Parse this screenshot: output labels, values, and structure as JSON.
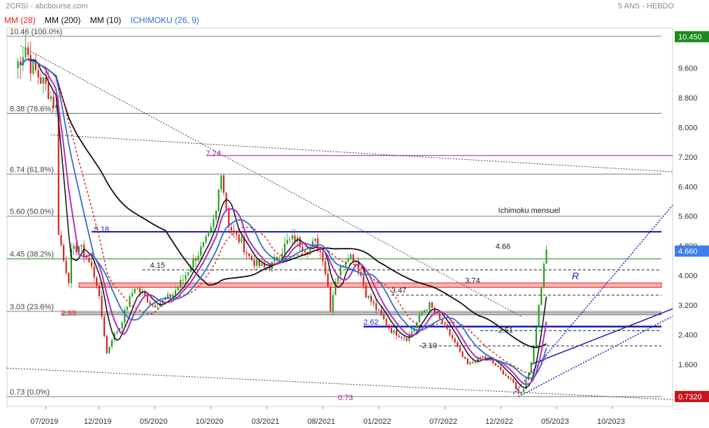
{
  "header": {
    "source": "2CRSI - abcbourse.com",
    "period": "5 ANS - HEBDO"
  },
  "legend": [
    {
      "label": "MM (28)",
      "color": "#e8271e"
    },
    {
      "label": "MM (200)",
      "color": "#111111"
    },
    {
      "label": "MM (10)",
      "color": "#111111"
    },
    {
      "label": "ICHIMOKU (26, 9)",
      "color": "#2f6fd6"
    }
  ],
  "chart_data": {
    "type": "candlestick",
    "y_ticks": [
      "10.400",
      "9.600",
      "8.800",
      "8.000",
      "7.200",
      "6.400",
      "5.600",
      "4.800",
      "4.000",
      "3.200",
      "2.400",
      "1.600",
      "0.8000"
    ],
    "y_tick_values": [
      10.4,
      9.6,
      8.8,
      8.0,
      7.2,
      6.4,
      5.6,
      4.8,
      4.0,
      3.2,
      2.4,
      1.6,
      0.8
    ],
    "ylim": [
      0.73,
      10.46
    ],
    "x_ticks": [
      "07/2019",
      "12/2019",
      "05/2020",
      "10/2020",
      "03/2021",
      "08/2021",
      "01/2022",
      "07/2022",
      "12/2022",
      "05/2023",
      "10/2023"
    ],
    "x_tick_index": [
      12,
      33,
      55,
      77,
      99,
      121,
      143,
      169,
      191,
      213,
      235
    ],
    "n_weeks": 255,
    "fib_levels": [
      {
        "label": "10.46  (100.0%)",
        "value": 10.46
      },
      {
        "label": "8.38  (78.6%)",
        "value": 8.38
      },
      {
        "label": "6.74  (61.8%)",
        "value": 6.74
      },
      {
        "label": "5.60  (50.0%)",
        "value": 5.6
      },
      {
        "label": "4.45  (38.2%)",
        "value": 4.45
      },
      {
        "label": "3.03  (23.6%)",
        "value": 3.03
      },
      {
        "label": "0.73  (0.0%)",
        "value": 0.73
      }
    ],
    "annotations": [
      {
        "text": "7.24",
        "value": 7.24,
        "color": "#9b1fa3"
      },
      {
        "text": "5.18",
        "value": 5.18,
        "color": "#1a1fb0"
      },
      {
        "text": "4.66",
        "value": 4.66,
        "color": "#222222"
      },
      {
        "text": "4.15",
        "value": 4.15,
        "color": "#222222"
      },
      {
        "text": "3.74",
        "value": 3.74,
        "color": "#222222"
      },
      {
        "text": "3.47",
        "value": 3.47,
        "color": "#222222"
      },
      {
        "text": "2.99",
        "value": 2.99,
        "color": "#e8271e"
      },
      {
        "text": "2.62",
        "value": 2.62,
        "color": "#1a1fb0"
      },
      {
        "text": "2.51",
        "value": 2.51,
        "color": "#222222"
      },
      {
        "text": "2.10",
        "value": 2.1,
        "color": "#222222"
      },
      {
        "text": "0.73",
        "value": 0.73,
        "color": "#9b1fa3"
      },
      {
        "text": "Ichimoku mensuel",
        "value": 5.65,
        "color": "#222222"
      },
      {
        "text": "R",
        "value": 3.9,
        "color": "#1a1fb0"
      }
    ],
    "last_price": {
      "text": "4.660",
      "value": 4.66,
      "color": "#3d7df0"
    },
    "high_label": {
      "text": "10.450",
      "value": 10.45,
      "color": "#1f8a1f"
    },
    "low_label": {
      "text": "0.7320",
      "value": 0.732,
      "color": "#c8141b"
    },
    "anchors": [
      [
        0,
        9.6
      ],
      [
        2,
        9.9
      ],
      [
        4,
        10.2
      ],
      [
        6,
        9.7
      ],
      [
        8,
        9.5
      ],
      [
        10,
        9.3
      ],
      [
        13,
        9.0
      ],
      [
        16,
        8.5
      ],
      [
        17,
        5.2
      ],
      [
        19,
        4.4
      ],
      [
        21,
        3.9
      ],
      [
        22,
        4.6
      ],
      [
        25,
        4.8
      ],
      [
        28,
        4.5
      ],
      [
        30,
        4.2
      ],
      [
        32,
        3.8
      ],
      [
        34,
        2.9
      ],
      [
        36,
        1.9
      ],
      [
        38,
        2.3
      ],
      [
        41,
        2.6
      ],
      [
        44,
        3.2
      ],
      [
        47,
        3.7
      ],
      [
        50,
        3.5
      ],
      [
        54,
        3.2
      ],
      [
        58,
        3.3
      ],
      [
        62,
        3.5
      ],
      [
        66,
        3.9
      ],
      [
        70,
        4.4
      ],
      [
        74,
        4.8
      ],
      [
        77,
        5.2
      ],
      [
        79,
        5.7
      ],
      [
        81,
        6.9
      ],
      [
        82,
        6.3
      ],
      [
        84,
        5.4
      ],
      [
        86,
        5.1
      ],
      [
        89,
        4.9
      ],
      [
        92,
        4.5
      ],
      [
        95,
        4.3
      ],
      [
        98,
        4.2
      ],
      [
        101,
        4.3
      ],
      [
        104,
        4.6
      ],
      [
        107,
        4.9
      ],
      [
        110,
        5.0
      ],
      [
        113,
        4.8
      ],
      [
        115,
        4.7
      ],
      [
        118,
        4.9
      ],
      [
        121,
        4.5
      ],
      [
        123,
        3.7
      ],
      [
        124,
        3.1
      ],
      [
        126,
        3.9
      ],
      [
        128,
        4.2
      ],
      [
        131,
        4.6
      ],
      [
        134,
        4.4
      ],
      [
        136,
        4.0
      ],
      [
        138,
        3.5
      ],
      [
        140,
        3.3
      ],
      [
        142,
        3.1
      ],
      [
        145,
        2.8
      ],
      [
        148,
        2.5
      ],
      [
        151,
        2.4
      ],
      [
        154,
        2.3
      ],
      [
        157,
        2.6
      ],
      [
        160,
        3.0
      ],
      [
        163,
        3.2
      ],
      [
        166,
        2.9
      ],
      [
        169,
        2.6
      ],
      [
        172,
        2.3
      ],
      [
        175,
        1.9
      ],
      [
        178,
        1.6
      ],
      [
        181,
        1.7
      ],
      [
        184,
        1.8
      ],
      [
        187,
        1.7
      ],
      [
        190,
        1.5
      ],
      [
        193,
        1.3
      ],
      [
        196,
        1.1
      ],
      [
        198,
        0.8
      ],
      [
        200,
        0.95
      ],
      [
        202,
        1.4
      ],
      [
        204,
        2.0
      ],
      [
        205,
        2.6
      ],
      [
        206,
        3.3
      ],
      [
        207,
        3.7
      ],
      [
        208,
        4.4
      ],
      [
        209,
        4.66
      ]
    ],
    "resistance_lines": [
      {
        "name": "Ichimoku mensuel",
        "value": 5.18,
        "color": "#1a1fb0"
      },
      {
        "name": "fib 38.2",
        "value": 4.45,
        "color": "#2f9e2f"
      },
      {
        "name": "4.15",
        "value": 4.15,
        "color": "#222222"
      },
      {
        "name": "3.74",
        "value": 3.74,
        "color": "#e8271e"
      },
      {
        "name": "3.47",
        "value": 3.47,
        "color": "#222222"
      },
      {
        "name": "2.99",
        "value": 2.99,
        "color": "#222222"
      },
      {
        "name": "2.62",
        "value": 2.62,
        "color": "#1a1fb0"
      },
      {
        "name": "2.51",
        "value": 2.51,
        "color": "#222222"
      },
      {
        "name": "2.10",
        "value": 2.1,
        "color": "#222222"
      }
    ]
  }
}
